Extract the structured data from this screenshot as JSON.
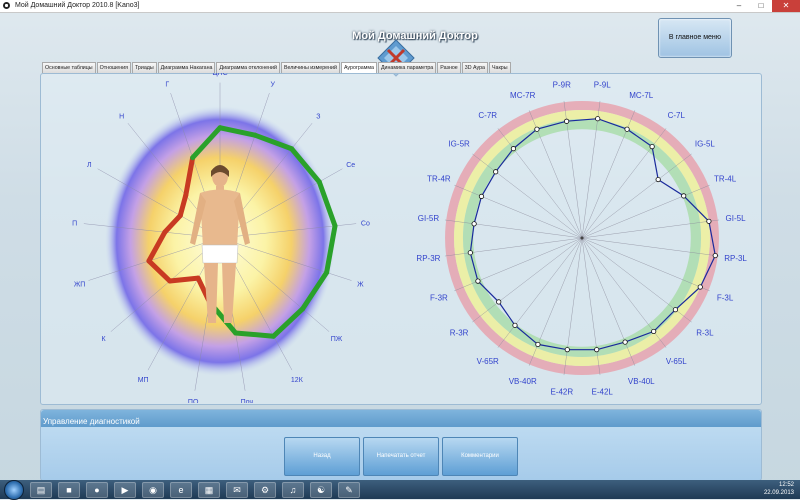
{
  "window": {
    "title": "Мой Домашний Доктор 2010.8 [Kano3]"
  },
  "header": {
    "app_title": "Мой Домашний Доктор",
    "main_menu_label": "В главное меню"
  },
  "tabs": [
    {
      "label": "Основные таблицы"
    },
    {
      "label": "Отношения"
    },
    {
      "label": "Триады"
    },
    {
      "label": "Диаграмма Накагана"
    },
    {
      "label": "Диаграмма отклонений"
    },
    {
      "label": "Величины измерений"
    },
    {
      "label": "Аурограмма",
      "active": true
    },
    {
      "label": "Динамика параметра"
    },
    {
      "label": "Разное"
    },
    {
      "label": "3D Аура"
    },
    {
      "label": "Чакры"
    }
  ],
  "aura_chart": {
    "labels": [
      "ЦНС",
      "У",
      "З",
      "Се",
      "Со",
      "Ж",
      "ПЖ",
      "12К",
      "Поч",
      "ПО",
      "МП",
      "К",
      "ЖП",
      "П",
      "Л",
      "Н",
      "Г"
    ],
    "values": [
      1.05,
      1.05,
      1.15,
      1.2,
      1.25,
      1.2,
      1.12,
      1.1,
      0.92,
      0.62,
      0.45,
      0.68,
      0.8,
      0.6,
      0.48,
      0.55,
      0.82
    ],
    "colors": {
      "high": "#2aa12a",
      "low": "#c83a22",
      "label": "#3344cc",
      "figure": "#e8b98e"
    }
  },
  "meridian_chart": {
    "labels": [
      "P-9R",
      "P-9L",
      "MC-7L",
      "C-7L",
      "IG-5L",
      "TR-4L",
      "GI-5L",
      "RP-3L",
      "F-3L",
      "R-3L",
      "V-65L",
      "VB-40L",
      "E-42L",
      "E-42R",
      "VB-40R",
      "V-65R",
      "R-3R",
      "F-3R",
      "RP-3R",
      "GI-5R",
      "TR-4R",
      "IG-5R",
      "C-7R",
      "MC-7R"
    ],
    "values": [
      0.92,
      0.94,
      0.92,
      0.9,
      0.75,
      0.86,
      1.0,
      1.05,
      1.0,
      0.92,
      0.92,
      0.88,
      0.88,
      0.88,
      0.9,
      0.86,
      0.82,
      0.88,
      0.88,
      0.85,
      0.85,
      0.85,
      0.88,
      0.92
    ],
    "rings": {
      "red": [
        1.0,
        1.07
      ],
      "yellow": [
        0.93,
        1.0
      ],
      "green": [
        0.85,
        0.93
      ]
    },
    "colors": {
      "line": "#1a2a9c",
      "label": "#3344cc"
    }
  },
  "diagnostics": {
    "title": "Управление диагностикой",
    "buttons": [
      {
        "label": "Назад"
      },
      {
        "label": "Напечатать отчет"
      },
      {
        "label": "Комментарии"
      }
    ]
  },
  "taskbar": {
    "time": "12:52",
    "date": "22.09.2013"
  }
}
